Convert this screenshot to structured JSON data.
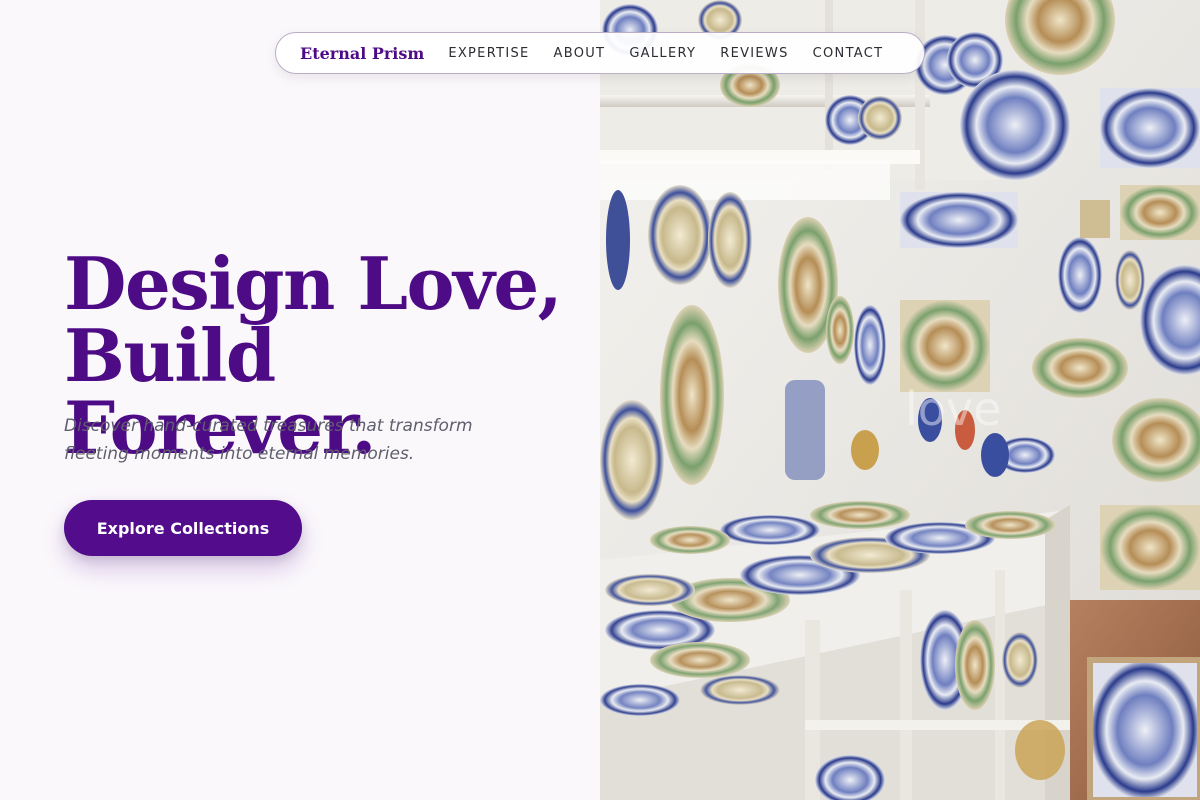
{
  "nav": {
    "brand": "Eternal Prism",
    "links": [
      "EXPERTISE",
      "ABOUT",
      "GALLERY",
      "REVIEWS",
      "CONTACT"
    ]
  },
  "hero": {
    "headline_line1": "Design Love,",
    "headline_line2": "Build Forever.",
    "subtitle_line1": "Discover hand-curated treasures that transform",
    "subtitle_line2": "fleeting moments into eternal memories.",
    "cta_label": "Explore Collections"
  },
  "image": {
    "subject": "ceramics shop wall with painted plates and pottery",
    "watermark": "love"
  },
  "colors": {
    "accent": "#520c8c",
    "headline": "#4e0b86",
    "background": "#fbf8fc",
    "body_text": "#5f5f6d"
  }
}
